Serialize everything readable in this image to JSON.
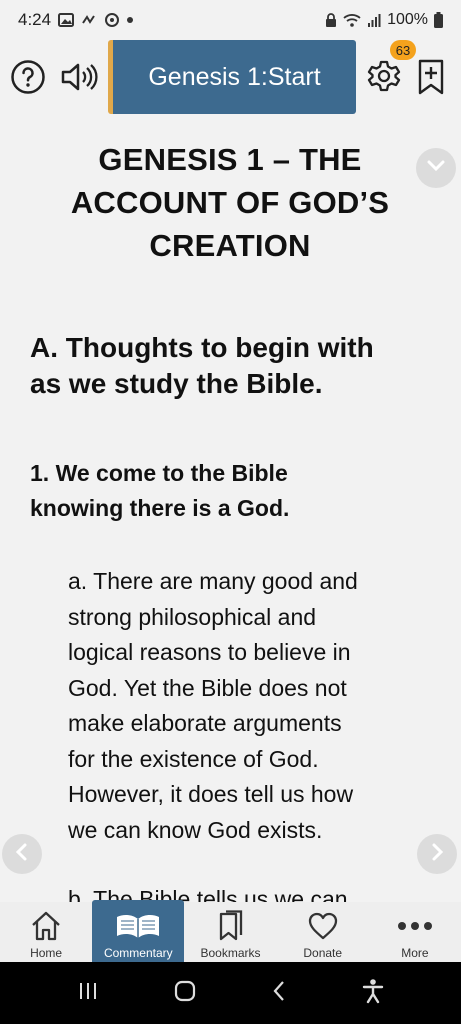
{
  "status_bar": {
    "time": "4:24",
    "battery": "100%"
  },
  "toolbar": {
    "title": "Genesis 1:Start",
    "badge_count": "63"
  },
  "content": {
    "title_lines": [
      "GENESIS 1 – THE",
      "ACCOUNT OF GOD’S",
      "CREATION"
    ],
    "section_a_lines": [
      "A. Thoughts to begin with",
      "as we study the Bible."
    ],
    "section_1_lines": [
      "1. We come to the Bible",
      "knowing there is a God."
    ],
    "para_a_lines": [
      "a. There are many good and",
      "strong philosophical and",
      "logical reasons to believe in",
      "God. Yet the Bible does not",
      "make elaborate arguments",
      "for the existence of God.",
      "However, it does tell us how",
      "we can know God exists."
    ],
    "para_b_partial": "b. The Bible tells us we can"
  },
  "bottom_nav": {
    "items": [
      {
        "label": "Home",
        "icon": "home-icon"
      },
      {
        "label": "Commentary",
        "icon": "open-book-icon"
      },
      {
        "label": "Bookmarks",
        "icon": "bookmarks-icon"
      },
      {
        "label": "Donate",
        "icon": "heart-icon"
      },
      {
        "label": "More",
        "icon": "more-icon"
      }
    ],
    "active_index": 1
  },
  "colors": {
    "accent": "#3d6a8f",
    "title_border": "#e0a84a",
    "badge": "#f4a21d"
  }
}
